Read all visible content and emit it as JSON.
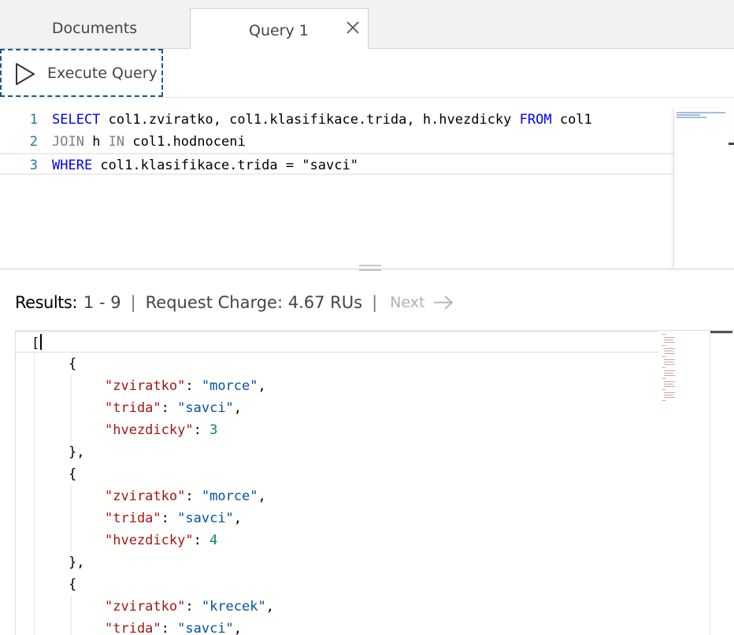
{
  "tabs": [
    {
      "label": "Documents",
      "active": false
    },
    {
      "label": "Query 1",
      "active": true
    }
  ],
  "toolbar": {
    "execute_label": "Execute Query"
  },
  "query_lines": [
    {
      "num": "1",
      "segments": [
        {
          "t": "SELECT",
          "c": "kw"
        },
        {
          "t": " col1.zviratko, col1.klasifikace.trida, h.hvezdicky ",
          "c": ""
        },
        {
          "t": "FROM",
          "c": "kw"
        },
        {
          "t": " col1",
          "c": ""
        }
      ]
    },
    {
      "num": "2",
      "segments": [
        {
          "t": "JOIN",
          "c": "kw2"
        },
        {
          "t": " h ",
          "c": ""
        },
        {
          "t": "IN",
          "c": "kw2"
        },
        {
          "t": " col1.hodnoceni",
          "c": ""
        }
      ]
    },
    {
      "num": "3",
      "segments": [
        {
          "t": "WHERE",
          "c": "kw"
        },
        {
          "t": " col1.klasifikace.trida = ",
          "c": ""
        },
        {
          "t": "\"savci\"",
          "c": ""
        }
      ]
    }
  ],
  "results_header": {
    "label": "Results:",
    "range": "1 - 9",
    "separator": "|",
    "charge": "Request Charge: 4.67 RUs",
    "next": "Next"
  },
  "result_lines": [
    {
      "indent": 0,
      "segments": [
        {
          "t": "[",
          "c": ""
        }
      ]
    },
    {
      "indent": 1,
      "segments": [
        {
          "t": "{",
          "c": ""
        }
      ]
    },
    {
      "indent": 2,
      "segments": [
        {
          "t": "\"zviratko\"",
          "c": "jkey"
        },
        {
          "t": ": ",
          "c": ""
        },
        {
          "t": "\"morce\"",
          "c": "jstr"
        },
        {
          "t": ",",
          "c": ""
        }
      ]
    },
    {
      "indent": 2,
      "segments": [
        {
          "t": "\"trida\"",
          "c": "jkey"
        },
        {
          "t": ": ",
          "c": ""
        },
        {
          "t": "\"savci\"",
          "c": "jstr"
        },
        {
          "t": ",",
          "c": ""
        }
      ]
    },
    {
      "indent": 2,
      "segments": [
        {
          "t": "\"hvezdicky\"",
          "c": "jkey"
        },
        {
          "t": ": ",
          "c": ""
        },
        {
          "t": "3",
          "c": "jnum"
        }
      ]
    },
    {
      "indent": 1,
      "segments": [
        {
          "t": "},",
          "c": ""
        }
      ]
    },
    {
      "indent": 1,
      "segments": [
        {
          "t": "{",
          "c": ""
        }
      ]
    },
    {
      "indent": 2,
      "segments": [
        {
          "t": "\"zviratko\"",
          "c": "jkey"
        },
        {
          "t": ": ",
          "c": ""
        },
        {
          "t": "\"morce\"",
          "c": "jstr"
        },
        {
          "t": ",",
          "c": ""
        }
      ]
    },
    {
      "indent": 2,
      "segments": [
        {
          "t": "\"trida\"",
          "c": "jkey"
        },
        {
          "t": ": ",
          "c": ""
        },
        {
          "t": "\"savci\"",
          "c": "jstr"
        },
        {
          "t": ",",
          "c": ""
        }
      ]
    },
    {
      "indent": 2,
      "segments": [
        {
          "t": "\"hvezdicky\"",
          "c": "jkey"
        },
        {
          "t": ": ",
          "c": ""
        },
        {
          "t": "4",
          "c": "jnum"
        }
      ]
    },
    {
      "indent": 1,
      "segments": [
        {
          "t": "},",
          "c": ""
        }
      ]
    },
    {
      "indent": 1,
      "segments": [
        {
          "t": "{",
          "c": ""
        }
      ]
    },
    {
      "indent": 2,
      "segments": [
        {
          "t": "\"zviratko\"",
          "c": "jkey"
        },
        {
          "t": ": ",
          "c": ""
        },
        {
          "t": "\"krecek\"",
          "c": "jstr"
        },
        {
          "t": ",",
          "c": ""
        }
      ]
    },
    {
      "indent": 2,
      "segments": [
        {
          "t": "\"trida\"",
          "c": "jkey"
        },
        {
          "t": ": ",
          "c": ""
        },
        {
          "t": "\"savci\"",
          "c": "jstr"
        },
        {
          "t": ",",
          "c": ""
        }
      ]
    }
  ],
  "colors": {
    "keyword": "#0000ff",
    "json_key": "#a31515",
    "json_string": "#0451a5",
    "json_number": "#098658",
    "line_number": "#237893",
    "focus_outline": "#1a5a8c"
  },
  "icons": {
    "close": "close-icon",
    "play": "play-icon",
    "next": "arrow-right-icon"
  }
}
